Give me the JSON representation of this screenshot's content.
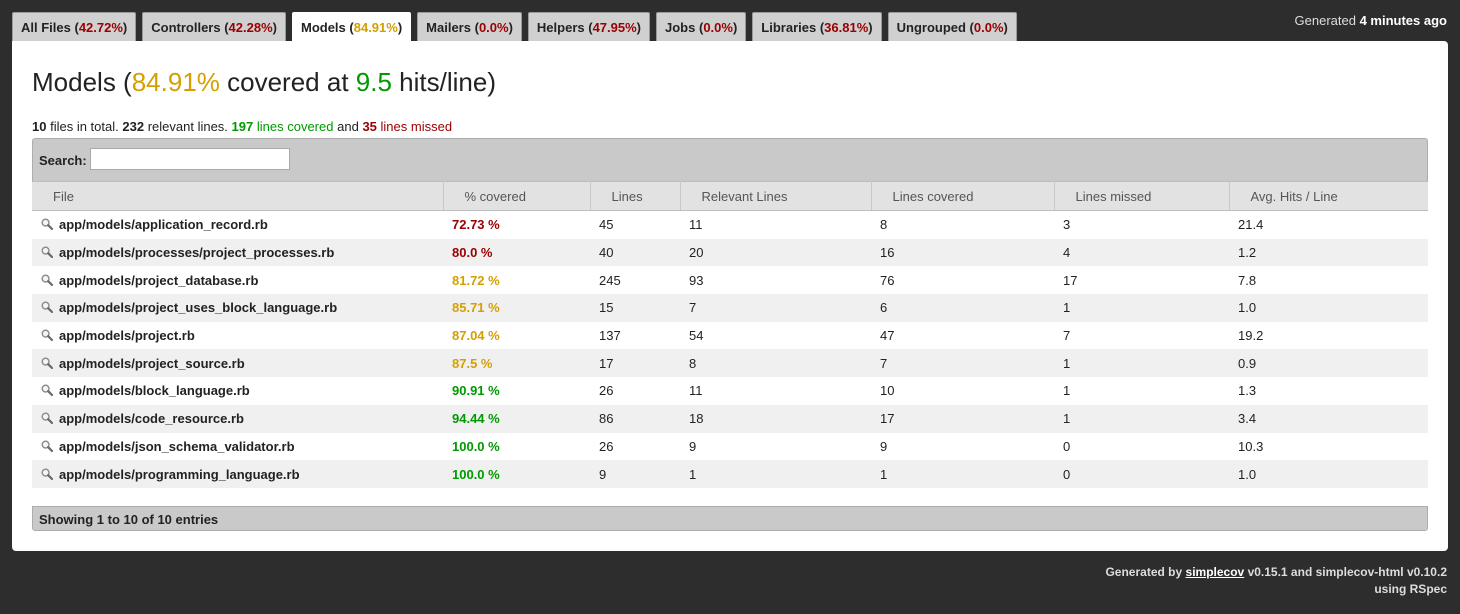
{
  "tabs": [
    {
      "label": "All Files",
      "pct": "42.72%",
      "color": "red",
      "active": false
    },
    {
      "label": "Controllers",
      "pct": "42.28%",
      "color": "red",
      "active": false
    },
    {
      "label": "Models",
      "pct": "84.91%",
      "color": "yellow",
      "active": true
    },
    {
      "label": "Mailers",
      "pct": "0.0%",
      "color": "red",
      "active": false
    },
    {
      "label": "Helpers",
      "pct": "47.95%",
      "color": "red",
      "active": false
    },
    {
      "label": "Jobs",
      "pct": "0.0%",
      "color": "red",
      "active": false
    },
    {
      "label": "Libraries",
      "pct": "36.81%",
      "color": "red",
      "active": false
    },
    {
      "label": "Ungrouped",
      "pct": "0.0%",
      "color": "red",
      "active": false
    }
  ],
  "generated_top": {
    "prefix": "Generated",
    "value": "4 minutes ago"
  },
  "title": {
    "group": "Models",
    "pct": "84.91%",
    "mid": "covered at",
    "hits": "9.5",
    "suffix": "hits/line"
  },
  "summary": {
    "files": "10",
    "files_text": "files in total.",
    "relevant": "232",
    "relevant_text": "relevant lines.",
    "covered": "197",
    "covered_text": "lines covered",
    "and": "and",
    "missed": "35",
    "missed_text": "lines missed"
  },
  "search": {
    "label": "Search:",
    "value": ""
  },
  "columns": [
    "File",
    "% covered",
    "Lines",
    "Relevant Lines",
    "Lines covered",
    "Lines missed",
    "Avg. Hits / Line"
  ],
  "rows": [
    {
      "file": "app/models/application_record.rb",
      "cov": "72.73 %",
      "color": "red",
      "lines": "45",
      "relevant": "11",
      "covered": "8",
      "missed": "3",
      "avg": "21.4"
    },
    {
      "file": "app/models/processes/project_processes.rb",
      "cov": "80.0 %",
      "color": "red",
      "lines": "40",
      "relevant": "20",
      "covered": "16",
      "missed": "4",
      "avg": "1.2"
    },
    {
      "file": "app/models/project_database.rb",
      "cov": "81.72 %",
      "color": "yellow",
      "lines": "245",
      "relevant": "93",
      "covered": "76",
      "missed": "17",
      "avg": "7.8"
    },
    {
      "file": "app/models/project_uses_block_language.rb",
      "cov": "85.71 %",
      "color": "yellow",
      "lines": "15",
      "relevant": "7",
      "covered": "6",
      "missed": "1",
      "avg": "1.0"
    },
    {
      "file": "app/models/project.rb",
      "cov": "87.04 %",
      "color": "yellow",
      "lines": "137",
      "relevant": "54",
      "covered": "47",
      "missed": "7",
      "avg": "19.2"
    },
    {
      "file": "app/models/project_source.rb",
      "cov": "87.5 %",
      "color": "yellow",
      "lines": "17",
      "relevant": "8",
      "covered": "7",
      "missed": "1",
      "avg": "0.9"
    },
    {
      "file": "app/models/block_language.rb",
      "cov": "90.91 %",
      "color": "green",
      "lines": "26",
      "relevant": "11",
      "covered": "10",
      "missed": "1",
      "avg": "1.3"
    },
    {
      "file": "app/models/code_resource.rb",
      "cov": "94.44 %",
      "color": "green",
      "lines": "86",
      "relevant": "18",
      "covered": "17",
      "missed": "1",
      "avg": "3.4"
    },
    {
      "file": "app/models/json_schema_validator.rb",
      "cov": "100.0 %",
      "color": "green",
      "lines": "26",
      "relevant": "9",
      "covered": "9",
      "missed": "0",
      "avg": "10.3"
    },
    {
      "file": "app/models/programming_language.rb",
      "cov": "100.0 %",
      "color": "green",
      "lines": "9",
      "relevant": "1",
      "covered": "1",
      "missed": "0",
      "avg": "1.0"
    }
  ],
  "info": "Showing 1 to 10 of 10 entries",
  "footer": {
    "line1_prefix": "Generated by",
    "link": "simplecov",
    "line1_suffix": "v0.15.1 and simplecov-html v0.10.2",
    "line2": "using RSpec"
  },
  "colors": {
    "red": "#990000",
    "yellow": "#d4a000",
    "green": "#009900",
    "background": "#2d2d2d"
  }
}
